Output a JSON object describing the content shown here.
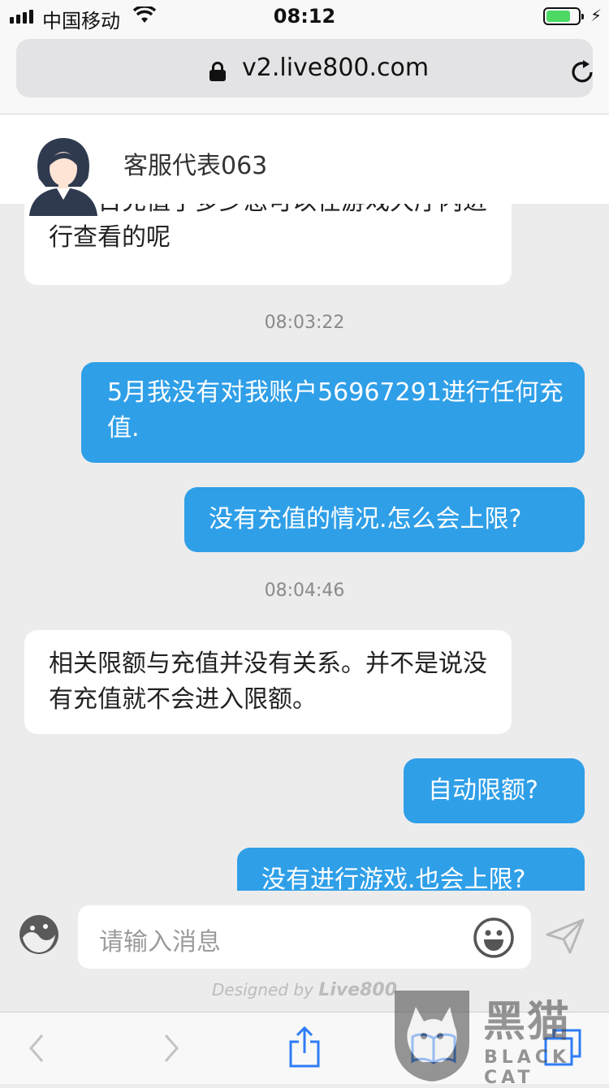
{
  "status_bar": {
    "carrier": "中国移动",
    "time": "08:12",
    "battery_level": 0.75,
    "battery_color": "#4cd964"
  },
  "browser": {
    "url": "v2.live800.com",
    "icons": [
      "lock-icon",
      "reload-icon"
    ]
  },
  "chat_header": {
    "agent_name": "客服代表063",
    "icons": [
      "agent-avatar",
      "thumbs-up-icon",
      "close-icon"
    ]
  },
  "messages": [
    {
      "sender": "agent",
      "text": "您当日充值了多少您可以在游戏大厅内进行查看的呢"
    },
    {
      "type": "timestamp",
      "text": "08:03:22"
    },
    {
      "sender": "user",
      "text": "5月我没有对我账户56967291进行任何充值."
    },
    {
      "sender": "user",
      "text": "没有充值的情况.怎么会上限?"
    },
    {
      "type": "timestamp",
      "text": "08:04:46"
    },
    {
      "sender": "agent",
      "text": "相关限额与充值并没有关系。并不是说没有充值就不会进入限额。"
    },
    {
      "sender": "user",
      "text": "自动限额?"
    },
    {
      "sender": "user",
      "text": "没有进行游戏.也会上限?"
    }
  ],
  "input": {
    "placeholder": "请输入消息",
    "icons": [
      "emoji-panel-icon",
      "smiley-icon",
      "send-icon"
    ]
  },
  "footer": {
    "designed_by": "Designed by",
    "brand": "Live800"
  },
  "toolbar": {
    "icons": [
      "back-icon",
      "forward-icon",
      "share-icon",
      "bookmarks-icon",
      "tabs-icon"
    ]
  },
  "watermark": {
    "title": "黑猫",
    "subtitle": "BLACK CAT"
  },
  "colors": {
    "user_bubble": "#2f9fe8",
    "agent_bubble": "#ffffff",
    "background": "#ececec",
    "ios_blue": "#2e7cf6"
  }
}
